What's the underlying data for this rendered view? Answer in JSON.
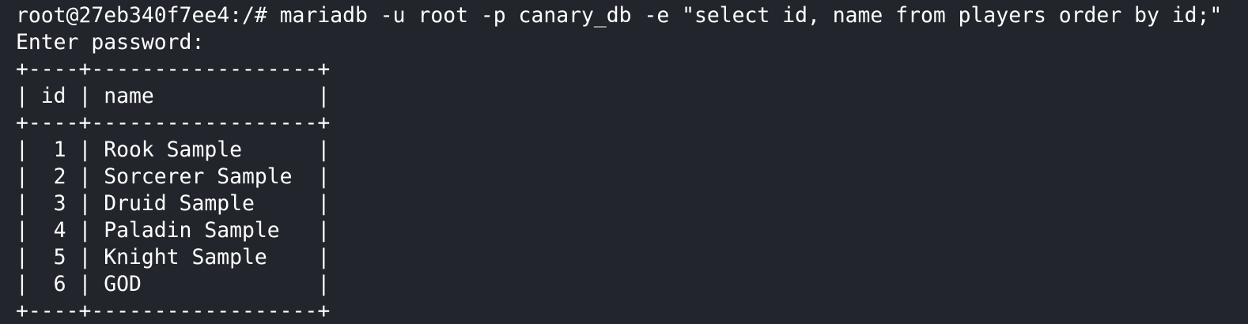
{
  "terminal": {
    "prompt": "root@27eb340f7ee4:/# ",
    "command": "mariadb -u root -p canary_db -e \"select id, name from players order by id;\"",
    "password_prompt": "Enter password:"
  },
  "result_table": {
    "border": "+----+------------------+",
    "header": "| id | name             |",
    "columns": [
      "id",
      "name"
    ],
    "rows": [
      {
        "id": 1,
        "name": "Rook Sample",
        "text": "|  1 | Rook Sample      |"
      },
      {
        "id": 2,
        "name": "Sorcerer Sample",
        "text": "|  2 | Sorcerer Sample  |"
      },
      {
        "id": 3,
        "name": "Druid Sample",
        "text": "|  3 | Druid Sample     |"
      },
      {
        "id": 4,
        "name": "Paladin Sample",
        "text": "|  4 | Paladin Sample   |"
      },
      {
        "id": 5,
        "name": "Knight Sample",
        "text": "|  5 | Knight Sample    |"
      },
      {
        "id": 6,
        "name": "GOD",
        "text": "|  6 | GOD              |"
      }
    ]
  },
  "colors": {
    "background": "#22262c",
    "foreground": "#ffffff"
  }
}
